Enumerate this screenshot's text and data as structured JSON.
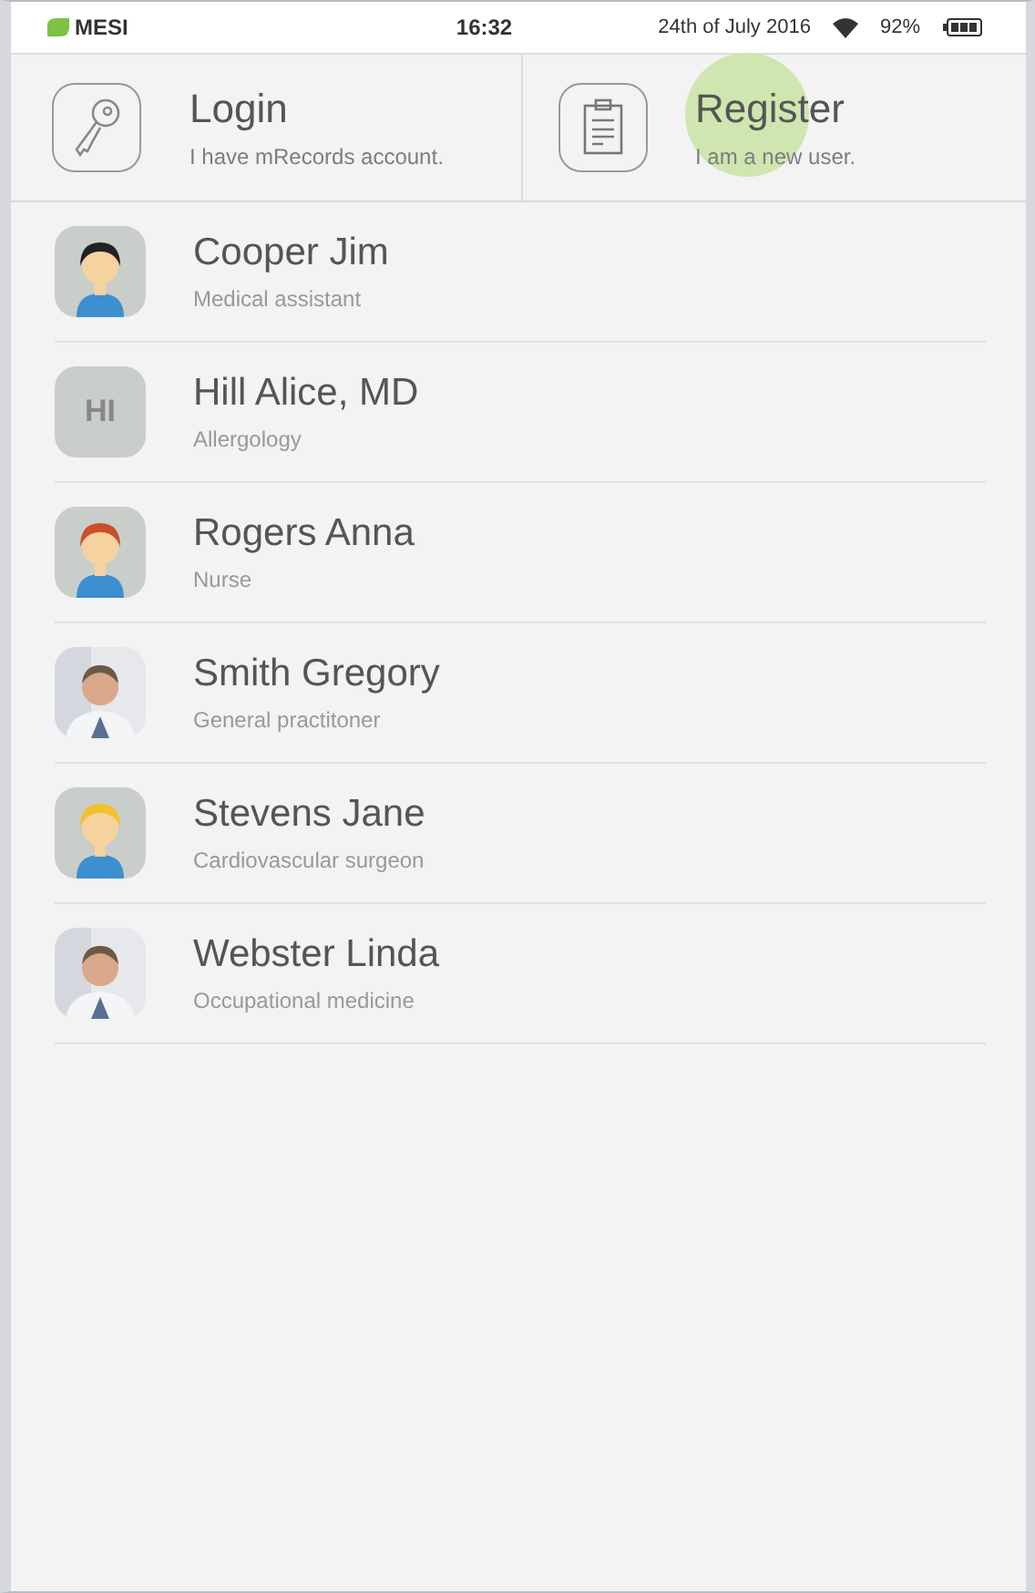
{
  "status_bar": {
    "brand": "MESI",
    "time": "16:32",
    "date": "24th of July 2016",
    "battery": "92%"
  },
  "actions": [
    {
      "kind": "login",
      "title": "Login",
      "subtitle": "I have mRecords account.",
      "pressed": false
    },
    {
      "kind": "register",
      "title": "Register",
      "subtitle": "I am a new user.",
      "pressed": true
    }
  ],
  "users": [
    {
      "name": "Cooper Jim",
      "role": "Medical assistant",
      "avatar": {
        "kind": "figure",
        "color": "#222222"
      }
    },
    {
      "name": "Hill Alice, MD",
      "role": "Allergology",
      "avatar": {
        "kind": "initials",
        "text": "HI"
      }
    },
    {
      "name": "Rogers Anna",
      "role": "Nurse",
      "avatar": {
        "kind": "figure",
        "color": "#c8502a"
      }
    },
    {
      "name": "Smith Gregory",
      "role": "General practitoner"
    },
    {
      "name": "Stevens Jane",
      "role": "Cardiovascular surgeon",
      "avatar": {
        "kind": "figure",
        "color": "#f2c12e"
      }
    },
    {
      "name": "Webster Linda",
      "role": "Occupational medicine"
    }
  ]
}
